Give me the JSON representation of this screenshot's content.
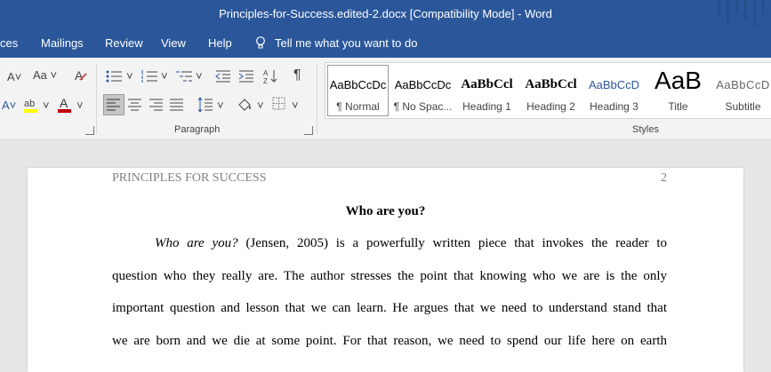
{
  "window": {
    "title": "Principles-for-Success.edited-2.docx [Compatibility Mode]  -  Word"
  },
  "menu": {
    "items": [
      "ces",
      "Mailings",
      "Review",
      "View",
      "Help"
    ],
    "tell_me": "Tell me what you want to do"
  },
  "ribbon": {
    "font_size_label": "Aa",
    "paragraph_label": "Paragraph",
    "styles_label": "Styles",
    "styles": [
      {
        "sample": "AaBbCcDc",
        "name": "¶ Normal"
      },
      {
        "sample": "AaBbCcDc",
        "name": "¶ No Spac..."
      },
      {
        "sample": "AaBbCcl",
        "name": "Heading 1"
      },
      {
        "sample": "AaBbCcl",
        "name": "Heading 2"
      },
      {
        "sample": "AaBbCcD",
        "name": "Heading 3"
      },
      {
        "sample": "AaB",
        "name": "Title"
      },
      {
        "sample": "AaBbCcD",
        "name": "Subtitle"
      }
    ],
    "colors": {
      "highlight": "#ffff00",
      "font_color": "#c00000",
      "accent": "#2b579a"
    }
  },
  "document": {
    "header": "PRINCIPLES FOR SUCCESS",
    "page_number": "2",
    "title": "Who are you?",
    "line1_italic": "Who are you?",
    "line1_rest": " (Jensen, 2005) is a powerfully written piece that invokes the reader to",
    "line2": "question who they really are. The author stresses the point that knowing who we are is the only",
    "line3": "important question and lesson that we can learn.  He argues that we need to understand stand that",
    "line4": "we are born and we die at some point. For that reason, we need to spend our life here on earth"
  }
}
